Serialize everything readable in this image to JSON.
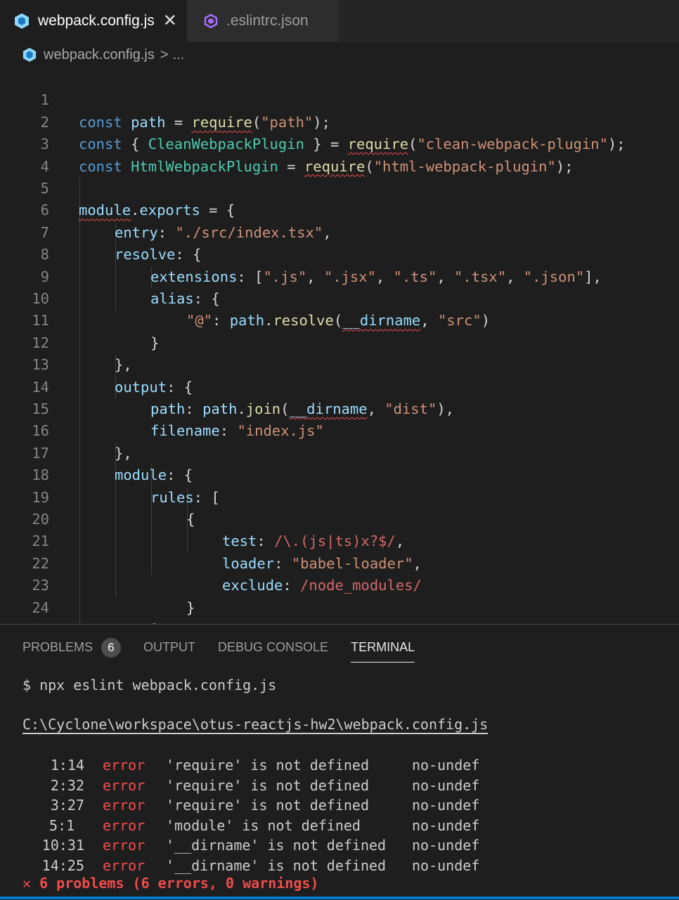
{
  "tabs": [
    {
      "label": "webpack.config.js",
      "icon": "webpack-icon",
      "active": true,
      "close": "✕"
    },
    {
      "label": ".eslintrc.json",
      "icon": "eslint-icon",
      "active": false
    }
  ],
  "breadcrumb": {
    "file": "webpack.config.js",
    "separator": ">",
    "more": "..."
  },
  "editor": {
    "line_numbers": [
      "1",
      "2",
      "3",
      "4",
      "5",
      "6",
      "7",
      "8",
      "9",
      "10",
      "11",
      "12",
      "13",
      "14",
      "15",
      "16",
      "17",
      "18",
      "19",
      "20",
      "21",
      "22",
      "23",
      "24",
      "25"
    ],
    "tokens": {
      "l1": [
        "const",
        "path",
        "=",
        "require",
        "(",
        "\"path\"",
        ");"
      ],
      "l2": [
        "const",
        "{ ",
        "CleanWebpackPlugin",
        " } = ",
        "require",
        "(",
        "\"clean-webpack-plugin\"",
        ");"
      ],
      "l3": [
        "const",
        "HtmlWebpackPlugin",
        "=",
        "require",
        "(",
        "\"html-webpack-plugin\"",
        ");"
      ],
      "l5": [
        "module",
        ".",
        "exports",
        " = {"
      ],
      "l6": [
        "entry",
        ": ",
        "\"./src/index.tsx\"",
        ","
      ],
      "l7": [
        "resolve",
        ": {"
      ],
      "l8": [
        "extensions",
        ": [",
        "\".js\"",
        ", ",
        "\".jsx\"",
        ", ",
        "\".ts\"",
        ", ",
        "\".tsx\"",
        ", ",
        "\".json\"",
        "],"
      ],
      "l9": [
        "alias",
        ": {"
      ],
      "l10": [
        "\"@\"",
        ": ",
        "path",
        ".",
        "resolve",
        "(",
        "__dirname",
        ", ",
        "\"src\"",
        ")"
      ],
      "l11": [
        "}"
      ],
      "l12": [
        "},"
      ],
      "l13": [
        "output",
        ": {"
      ],
      "l14": [
        "path",
        ": ",
        "path",
        ".",
        "join",
        "(",
        "__dirname",
        ", ",
        "\"dist\"",
        "),"
      ],
      "l15": [
        "filename",
        ": ",
        "\"index.js\""
      ],
      "l16": [
        "},"
      ],
      "l17": [
        "module",
        ": {"
      ],
      "l18": [
        "rules",
        ": ["
      ],
      "l19": [
        "{"
      ],
      "l20": [
        "test",
        ": ",
        "/\\.(js|ts)x?$/",
        ","
      ],
      "l21": [
        "loader",
        ": ",
        "\"babel-loader\"",
        ","
      ],
      "l22": [
        "exclude",
        ": ",
        "/node_modules/"
      ],
      "l23": [
        "}"
      ],
      "l24": [
        "]"
      ],
      "l25": [
        "},"
      ]
    }
  },
  "panel": {
    "tabs": [
      "PROBLEMS",
      "OUTPUT",
      "DEBUG CONSOLE",
      "TERMINAL"
    ],
    "active_tab": "TERMINAL",
    "problems_count": "6",
    "terminal": {
      "command": "$ npx eslint webpack.config.js",
      "file_path": "C:\\Cyclone\\workspace\\otus-reactjs-hw2\\webpack.config.js",
      "errors": [
        {
          "loc": "1:14",
          "severity": "error",
          "message": "'require' is not defined",
          "rule": "no-undef"
        },
        {
          "loc": "2:32",
          "severity": "error",
          "message": "'require' is not defined",
          "rule": "no-undef"
        },
        {
          "loc": "3:27",
          "severity": "error",
          "message": "'require' is not defined",
          "rule": "no-undef"
        },
        {
          "loc": "5:1",
          "severity": "error",
          "message": "'module' is not defined",
          "rule": "no-undef"
        },
        {
          "loc": "10:31",
          "severity": "error",
          "message": "'__dirname' is not defined",
          "rule": "no-undef"
        },
        {
          "loc": "14:25",
          "severity": "error",
          "message": "'__dirname' is not defined",
          "rule": "no-undef"
        }
      ],
      "summary": "✕ 6 problems (6 errors, 0 warnings)"
    }
  },
  "colors": {
    "background": "#1e1e1e",
    "keyword": "#569cd6",
    "class": "#4ec9b0",
    "string": "#ce9178",
    "function": "#dcdcaa",
    "property": "#9cdcfe",
    "regex": "#d16969",
    "error": "#f14c4c",
    "accent": "#007acc"
  }
}
